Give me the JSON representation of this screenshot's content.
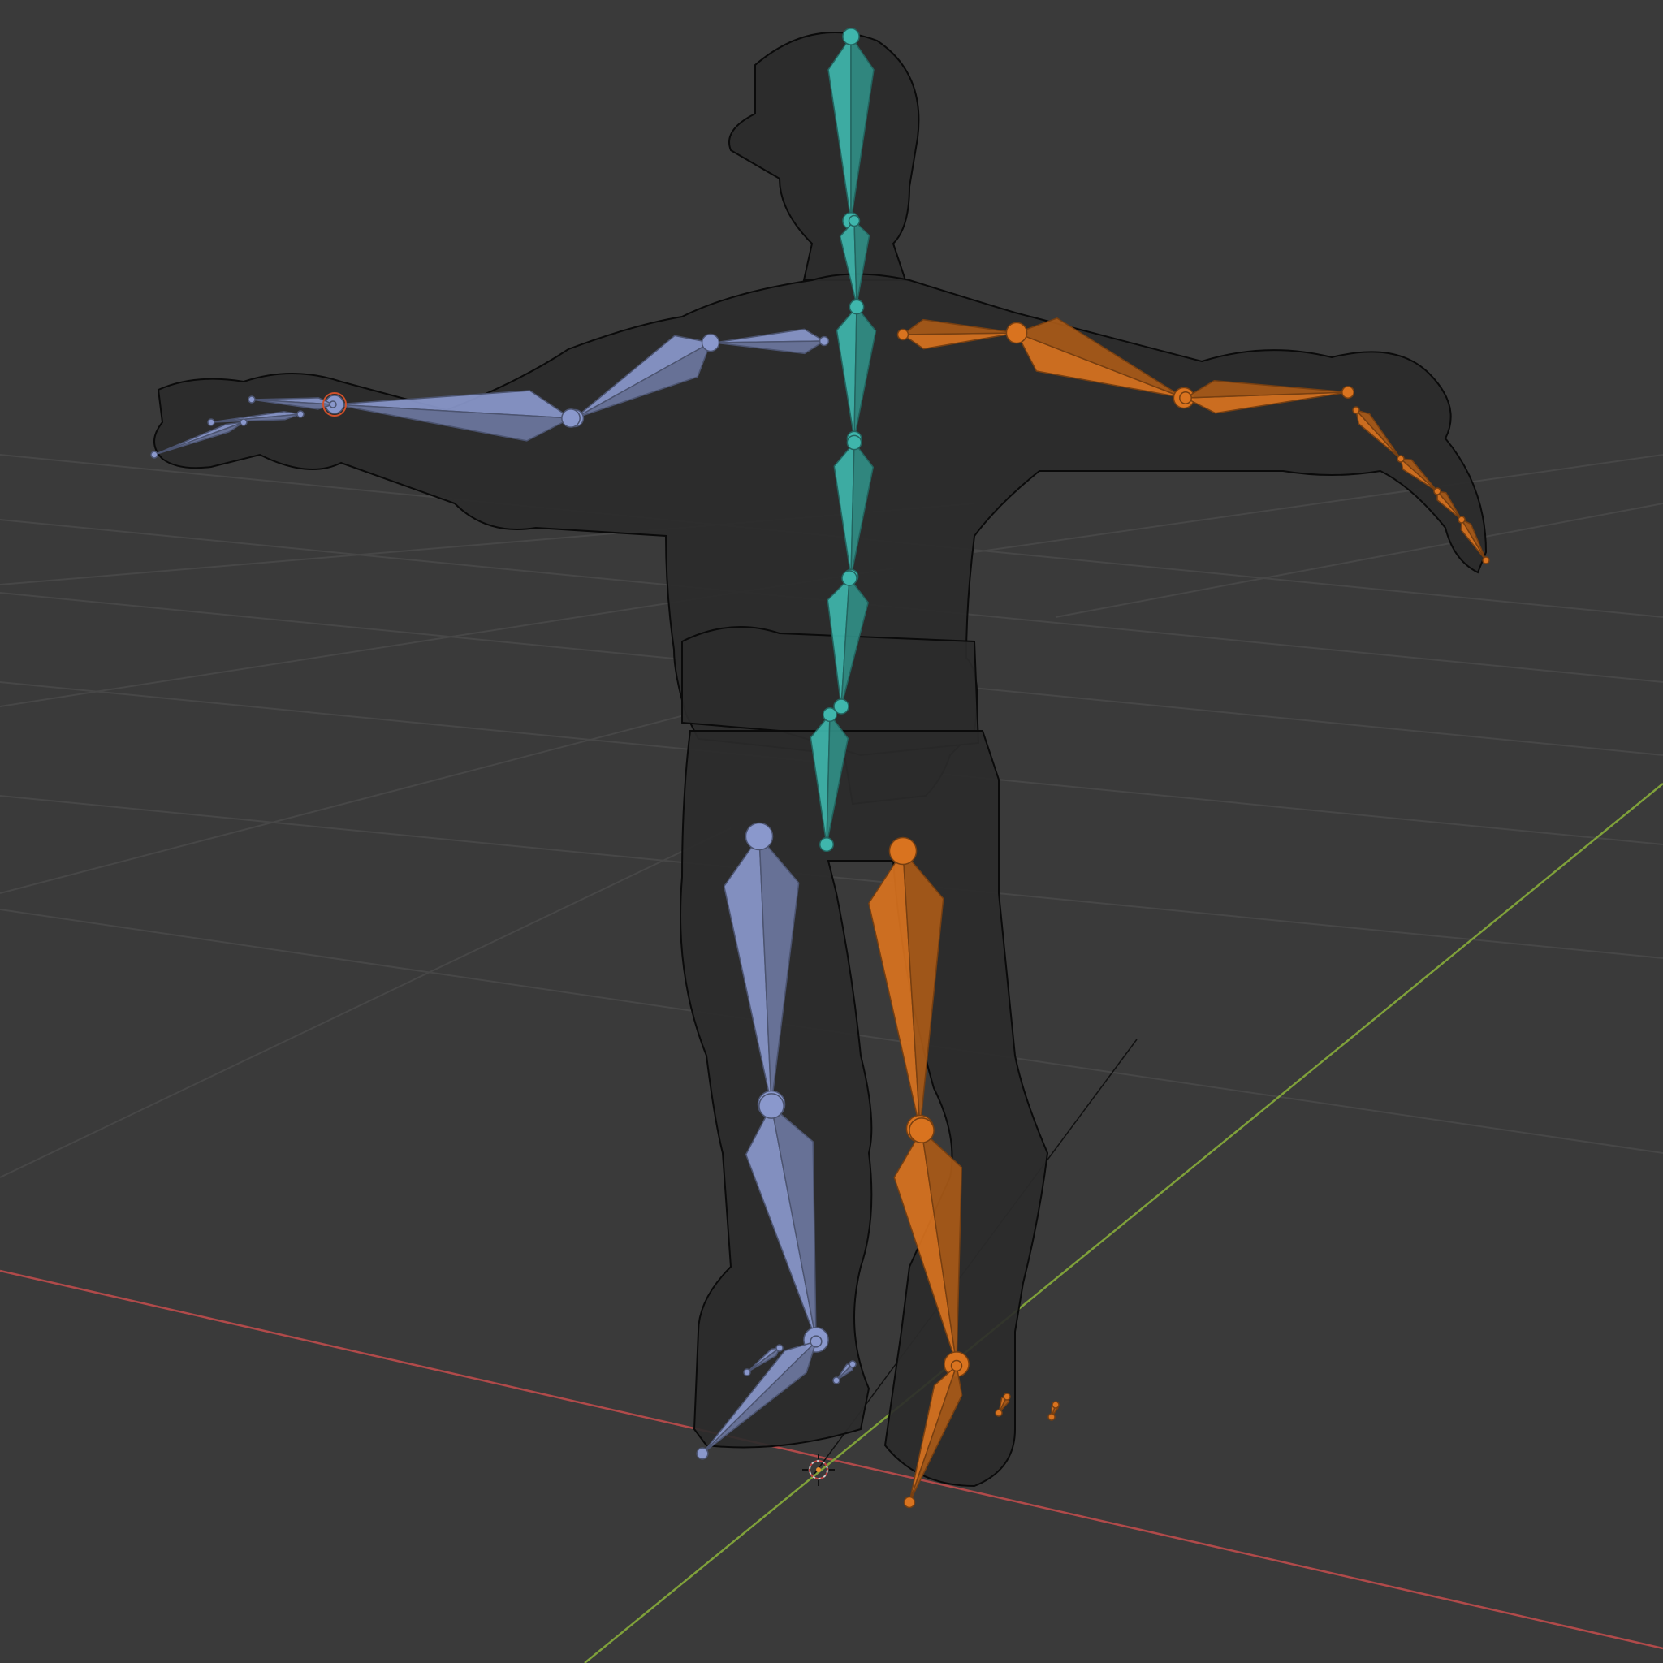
{
  "viewport": {
    "mode": "3D viewport",
    "background": "#3a3a3a",
    "grid_color": "#474747",
    "x_axis_color": "#b04a4a",
    "y_axis_color": "#7fa03a",
    "wireframe_color": "#0f0f0f"
  },
  "armature": {
    "spine_color": "#3fb6ac",
    "left_side_color": "#8a98cc",
    "right_side_color": "#d9731f",
    "bones": [
      "head",
      "neck",
      "spine-3",
      "spine-2",
      "spine-1",
      "hips",
      "upper-arm-left",
      "forearm-left",
      "hand-left",
      "upper-arm-right",
      "forearm-right",
      "hand-right",
      "thigh-left",
      "shin-left",
      "foot-left",
      "thigh-right",
      "shin-right",
      "foot-right"
    ]
  },
  "objects": {
    "mesh": "character-wireframe",
    "origin": "3d-cursor"
  }
}
